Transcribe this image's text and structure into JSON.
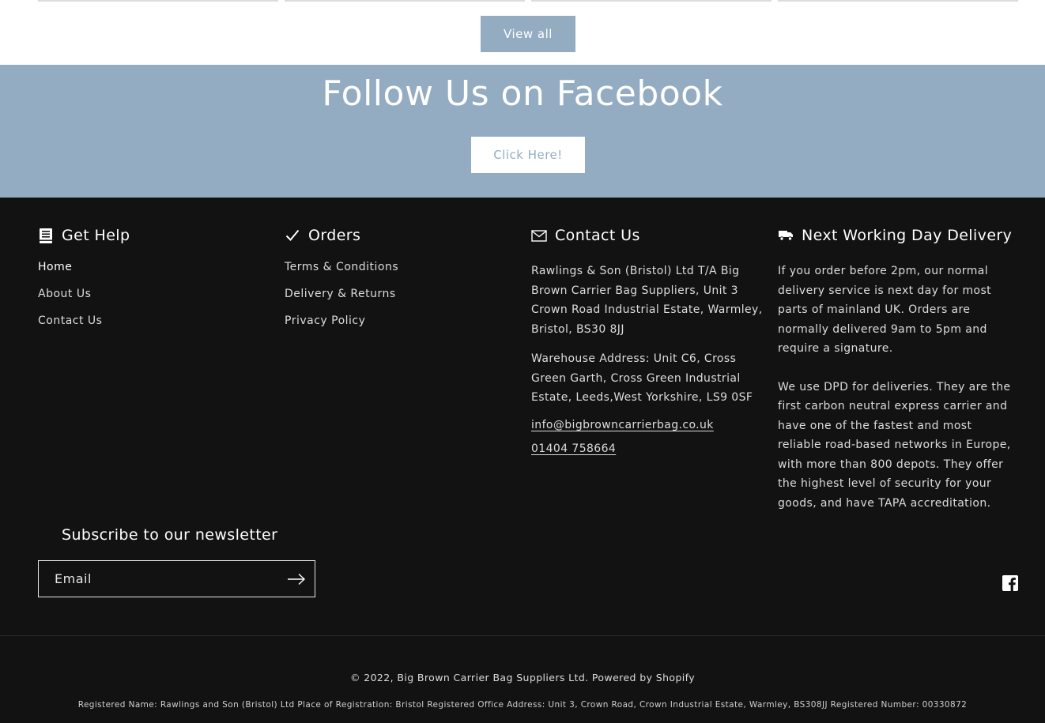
{
  "top": {
    "view_all_label": "View all"
  },
  "facebook_banner": {
    "title": "Follow Us on Facebook",
    "button_label": "Click Here!"
  },
  "footer": {
    "get_help": {
      "heading": "Get Help",
      "icon": "book-icon",
      "links": [
        "Home",
        "About Us",
        "Contact Us"
      ]
    },
    "orders": {
      "heading": "Orders",
      "icon": "checkmark-icon",
      "links": [
        "Terms & Conditions",
        "Delivery & Returns",
        "Privacy Policy"
      ]
    },
    "contact": {
      "heading": "Contact Us",
      "icon": "envelope-icon",
      "address": "Rawlings & Son (Bristol) Ltd T/A Big Brown Carrier Bag Suppliers, Unit 3 Crown Road Industrial Estate, Warmley, Bristol, BS30 8JJ",
      "warehouse": "Warehouse Address: Unit C6, Cross Green Garth, Cross Green Industrial Estate, Leeds,West Yorkshire, LS9 0SF",
      "email": "info@bigbrowncarrierbag.co.uk",
      "phone": "01404 758664"
    },
    "delivery": {
      "heading": "Next Working Day Delivery",
      "icon": "truck-icon",
      "para1": "If you order before 2pm, our normal delivery service is next day for most parts of mainland UK. Orders are normally delivered 9am to 5pm and require a signature.",
      "para2": "We use DPD for deliveries. They are the first carbon neutral express carrier and have one of the fastest and most reliable road-based networks in Europe, with more than 800 depots. They offer the highest level of security for your goods, and have TAPA accreditation."
    },
    "newsletter": {
      "title": "Subscribe to our newsletter",
      "placeholder": "Email"
    },
    "copyright": "© 2022, Big Brown Carrier Bag Suppliers Ltd. Powered by Shopify",
    "registered": "Registered Name: Rawlings and Son (Bristol) Ltd Place of Registration: Bristol Registered Office Address: Unit 3, Crown Road, Crown Industrial Estate, Warmley, BS308JJ Registered Number: 00330872"
  },
  "colors": {
    "banner": "#93acc2",
    "footer_bg": "#121212"
  }
}
